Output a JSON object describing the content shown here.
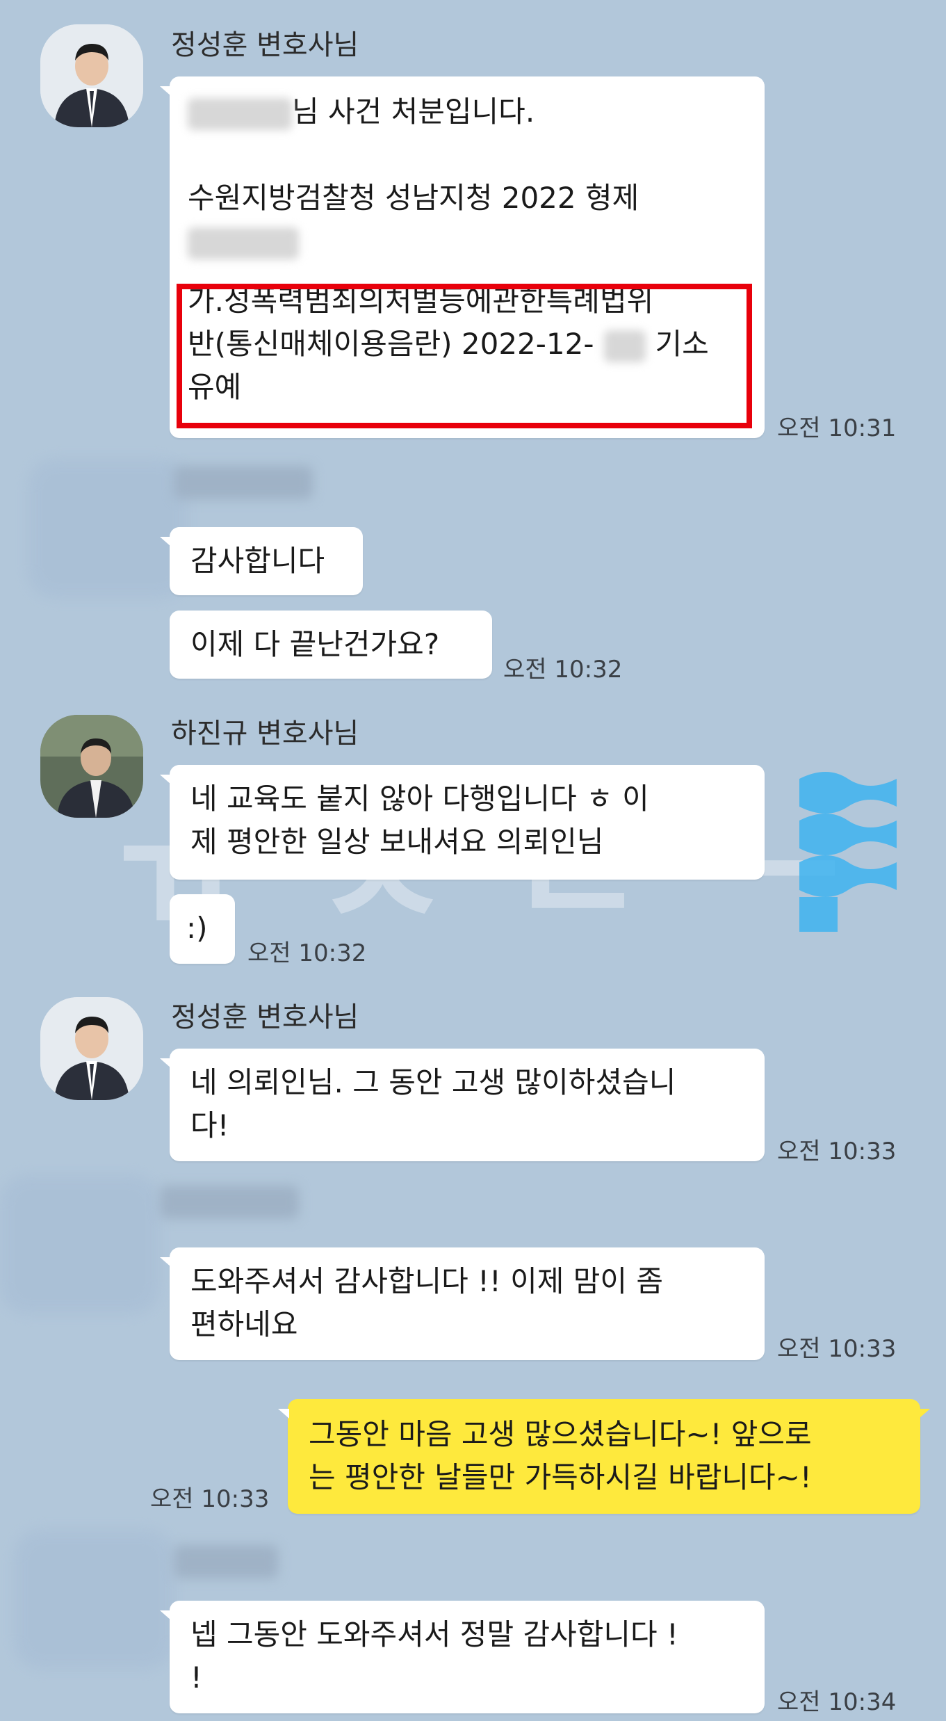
{
  "messages": {
    "m1": {
      "sender": "정성훈 변호사님",
      "line1_suffix": "님 사건 처분입니다.",
      "line2": "수원지방검찰청 성남지청 2022 형제",
      "line3a": "가.성폭력범죄의처벌등에관한특례법위",
      "line3b_pre": "반(통신매체이용음란)  2022-12-",
      "line3b_post": "기소",
      "line3c": "유예",
      "time": "오전 10:31"
    },
    "m2": {
      "text1": "감사합니다",
      "text2": "이제 다 끝난건가요?",
      "time": "오전 10:32"
    },
    "m3": {
      "sender": "하진규 변호사님",
      "line1": "네 교육도 붙지 않아 다행입니다 ㅎ 이",
      "line2": "제 평안한 일상 보내셔요 의뢰인님",
      "text2": ":)",
      "time": "오전 10:32"
    },
    "m4": {
      "sender": "정성훈 변호사님",
      "line1": "네 의뢰인님. 그 동안 고생 많이하셨습니",
      "line2": "다!",
      "time": "오전 10:33"
    },
    "m5": {
      "line1": "도와주셔서 감사합니다 !! 이제 맘이 좀",
      "line2": "편하네요",
      "time": "오전 10:33"
    },
    "m6": {
      "line1": "그동안 마음 고생 많으셨습니다~! 앞으로",
      "line2": "는 평안한 날들만 가득하시길 바랍니다~!",
      "time": "오전 10:33"
    },
    "m7": {
      "line1": "넵 그동안 도와주셔서 정말 감사합니다 !",
      "line2": "!",
      "time": "오전 10:34"
    }
  },
  "colors": {
    "background": "#b2c7da",
    "bubble_other": "#ffffff",
    "bubble_me": "#fee93d",
    "highlight_box": "#e8000b",
    "watermark_accent": "#3fb4f0"
  },
  "icons": [
    "lawyer-avatar-icon",
    "client-avatar-blurred"
  ]
}
